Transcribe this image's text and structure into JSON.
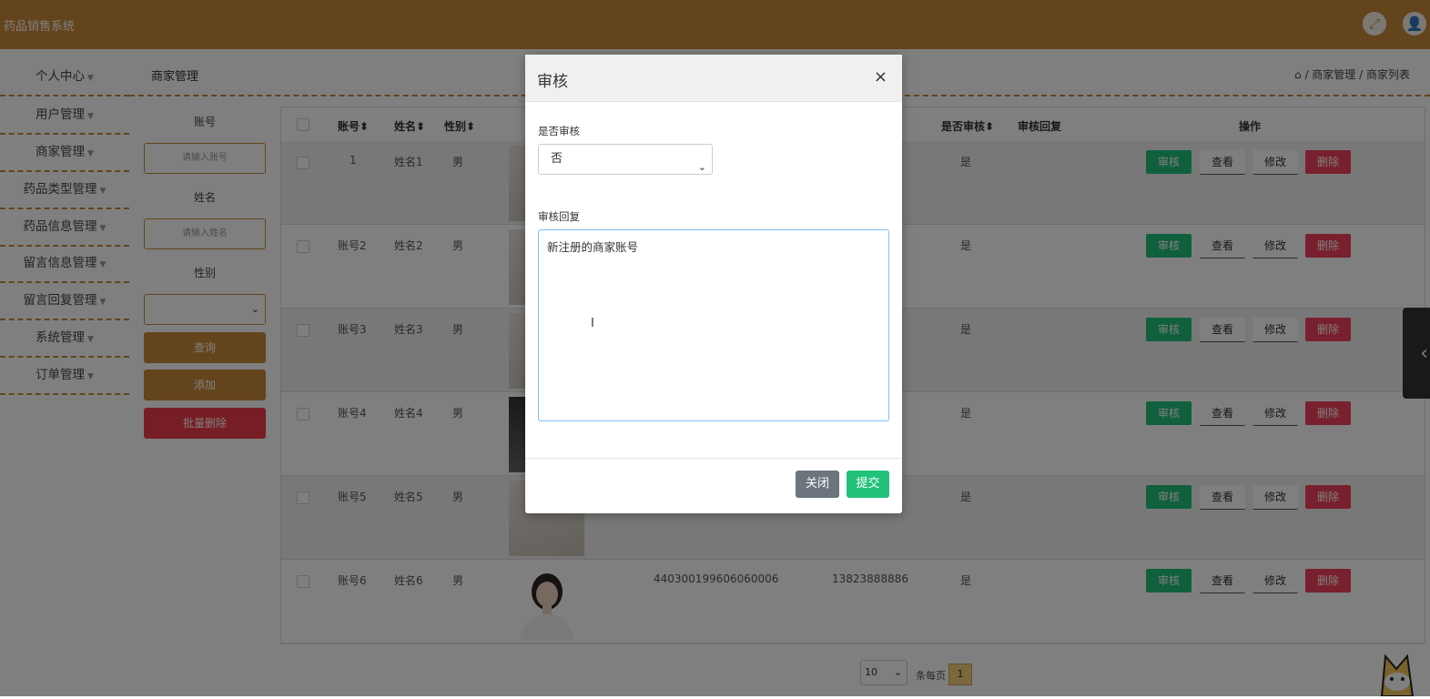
{
  "app": {
    "title": "药品销售系统"
  },
  "colors": {
    "brand": "#c9883a",
    "success": "#22c17a",
    "danger": "#f0405a"
  },
  "sidebar": {
    "items": [
      "个人中心",
      "用户管理",
      "商家管理",
      "药品类型管理",
      "药品信息管理",
      "留言信息管理",
      "留言回复管理",
      "系统管理",
      "订单管理"
    ]
  },
  "content": {
    "title": "商家管理",
    "breadcrumb": [
      "商家管理",
      "商家列表"
    ]
  },
  "filters": {
    "account_label": "账号",
    "account_placeholder": "请输入账号",
    "name_label": "姓名",
    "name_placeholder": "请输入姓名",
    "gender_label": "性别",
    "query": "查询",
    "add": "添加",
    "batch_delete": "批量删除"
  },
  "table": {
    "headers": [
      "账号",
      "姓名",
      "性别",
      "是否审核",
      "审核回复",
      "操作"
    ],
    "sort_icon": "⬍",
    "rows": [
      {
        "account": "1",
        "name": "姓名1",
        "gender": "男",
        "audited": "是"
      },
      {
        "account": "账号2",
        "name": "姓名2",
        "gender": "男",
        "audited": "是"
      },
      {
        "account": "账号3",
        "name": "姓名3",
        "gender": "男",
        "audited": "是"
      },
      {
        "account": "账号4",
        "name": "姓名4",
        "gender": "男",
        "audited": "是"
      },
      {
        "account": "账号5",
        "name": "姓名5",
        "gender": "男",
        "audited": "是"
      },
      {
        "account": "账号6",
        "name": "姓名6",
        "gender": "男",
        "audited": "是",
        "id_card": "440300199606060006",
        "phone": "13823888886"
      }
    ],
    "actions": {
      "audit": "审核",
      "view": "查看",
      "edit": "修改",
      "delete": "删除"
    }
  },
  "pager": {
    "page_size": "10",
    "per_page_label": "条每页",
    "current_page": "1"
  },
  "modal": {
    "title": "审核",
    "close_symbol": "×",
    "audit_label": "是否审核",
    "audit_value": "否",
    "reply_label": "审核回复",
    "reply_value": "新注册的商家账号",
    "btn_close": "关闭",
    "btn_submit": "提交"
  }
}
